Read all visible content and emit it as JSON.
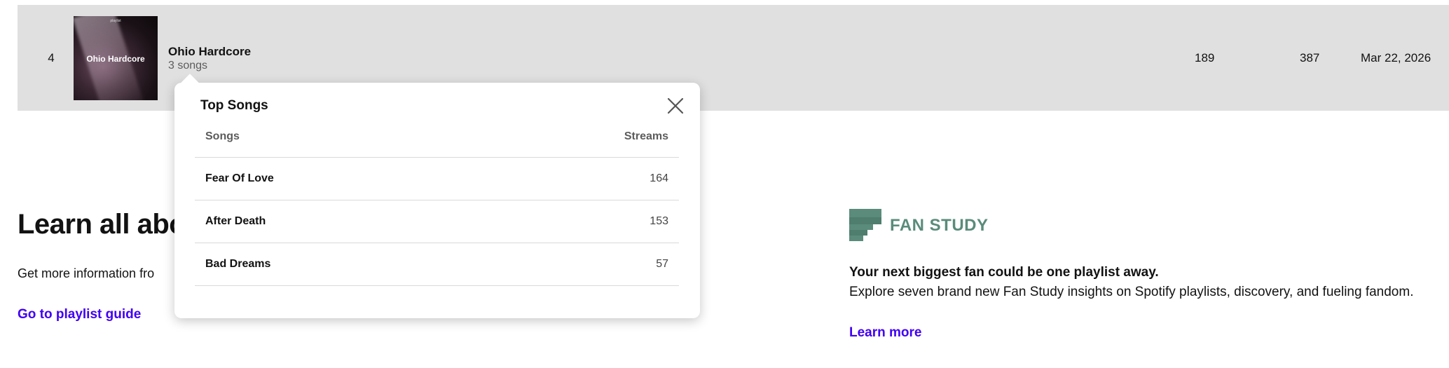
{
  "playlist_row": {
    "rank": "4",
    "cover_small_text": "playlist",
    "cover_title": "Ohio Hardcore",
    "name": "Ohio Hardcore",
    "song_count": "3 songs",
    "col1": "189",
    "col2": "387",
    "date": "Mar 22, 2026"
  },
  "learn": {
    "title": "Learn all abo",
    "subtitle": "Get more information fro",
    "guide_link": "Go to playlist guide"
  },
  "fan_study": {
    "logo_word": "FAN STUDY",
    "headline": "Your next biggest fan could be one playlist away.",
    "description": "Explore seven brand new Fan Study insights on Spotify playlists, discovery, and fueling fandom.",
    "link": "Learn more",
    "brand_color": "#5a8b7b"
  },
  "popover": {
    "title": "Top Songs",
    "close_icon": "close-icon",
    "columns": [
      "Songs",
      "Streams"
    ],
    "rows": [
      {
        "song": "Fear Of Love",
        "streams": "164"
      },
      {
        "song": "After Death",
        "streams": "153"
      },
      {
        "song": "Bad Dreams",
        "streams": "57"
      }
    ]
  },
  "colors": {
    "link": "#4100f5",
    "row_highlight": "#e0e0e0"
  }
}
